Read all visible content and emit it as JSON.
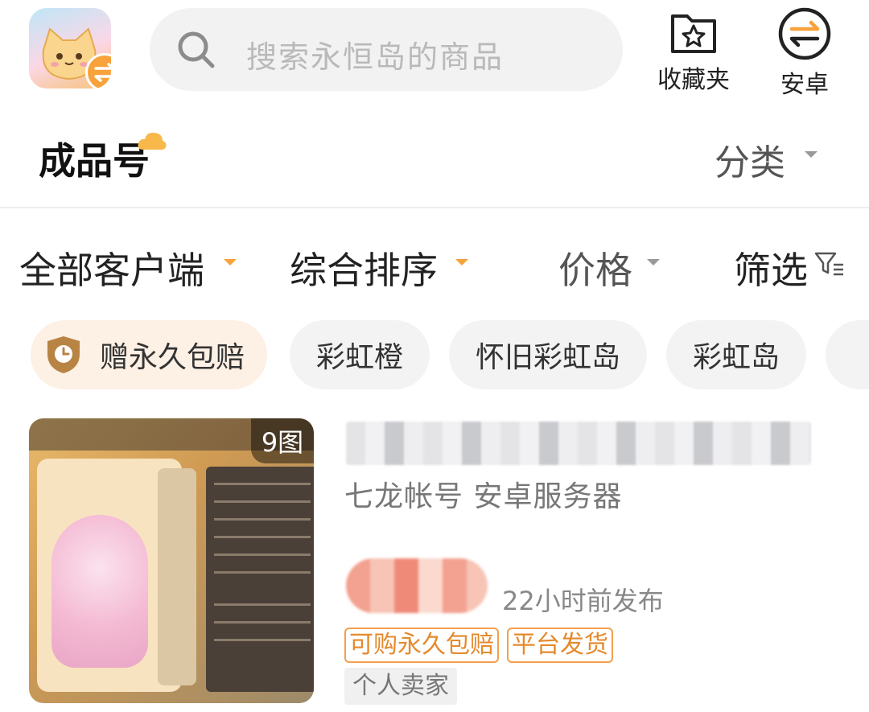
{
  "header": {
    "search_placeholder": "搜索永恒岛的商品",
    "favorites_label": "收藏夹",
    "android_label": "安卓"
  },
  "section": {
    "title": "成品号",
    "category_label": "分类"
  },
  "filters": {
    "client": "全部客户端",
    "sort": "综合排序",
    "price": "价格",
    "filter": "筛选"
  },
  "chips": [
    "赠永久包赔",
    "彩虹橙",
    "怀旧彩虹岛",
    "彩虹岛"
  ],
  "listing": {
    "image_count": "9图",
    "subtitle": "七龙帐号 安卓服务器",
    "posted": "22小时前发布",
    "tags": [
      "可购永久包赔",
      "平台发货"
    ],
    "seller_type": "个人卖家"
  },
  "colors": {
    "accent": "#f7a23a",
    "chip_bg": "#f3f3f3",
    "highlight_chip_bg": "#fdf0e4",
    "tag_border": "#f2a04c"
  },
  "icons": [
    "app-logo-icon",
    "search-icon",
    "star-folder-icon",
    "swap-icon",
    "clock-shield-icon",
    "filter-icon"
  ]
}
